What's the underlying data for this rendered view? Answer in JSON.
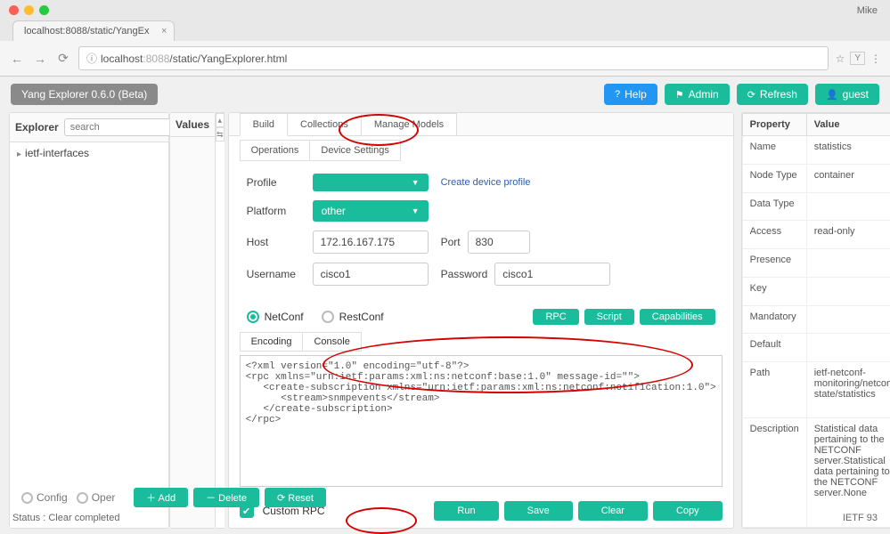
{
  "browser": {
    "user": "Mike",
    "tab_title": "localhost:8088/static/YangEx",
    "url_host": "localhost",
    "url_port": ":8088",
    "url_path": "/static/YangExplorer.html"
  },
  "app": {
    "title": "Yang Explorer 0.6.0 (Beta)",
    "help": "Help",
    "admin": "Admin",
    "refresh": "Refresh",
    "guest": "guest"
  },
  "explorer": {
    "title": "Explorer",
    "search_placeholder": "search",
    "tree_item": "ietf-interfaces",
    "values_title": "Values",
    "config": "Config",
    "oper": "Oper",
    "add": "Add",
    "delete": "Delete",
    "reset": "Reset"
  },
  "center": {
    "tabs": {
      "build": "Build",
      "collections": "Collections",
      "manage": "Manage Models"
    },
    "subtabs": {
      "operations": "Operations",
      "device": "Device Settings"
    },
    "profile_label": "Profile",
    "profile_value": "",
    "create_profile": "Create device profile",
    "platform_label": "Platform",
    "platform_value": "other",
    "host_label": "Host",
    "host_value": "172.16.167.175",
    "port_label": "Port",
    "port_value": "830",
    "user_label": "Username",
    "user_value": "cisco1",
    "pass_label": "Password",
    "pass_value": "cisco1",
    "netconf": "NetConf",
    "restconf": "RestConf",
    "rpc": "RPC",
    "script": "Script",
    "caps": "Capabilities",
    "encoding": "Encoding",
    "console": "Console",
    "xml": "<?xml version=\"1.0\" encoding=\"utf-8\"?>\n<rpc xmlns=\"urn:ietf:params:xml:ns:netconf:base:1.0\" message-id=\"\">\n   <create-subscription xmlns=\"urn:ietf:params:xml:ns:netconf:notification:1.0\">\n      <stream>snmpevents</stream>\n   </create-subscription>\n</rpc>",
    "custom_rpc": "Custom RPC",
    "run": "Run",
    "save": "Save",
    "clear": "Clear",
    "copy": "Copy"
  },
  "props": {
    "header_prop": "Property",
    "header_val": "Value",
    "rows": [
      {
        "k": "Name",
        "v": "statistics"
      },
      {
        "k": "Node Type",
        "v": "container"
      },
      {
        "k": "Data Type",
        "v": ""
      },
      {
        "k": "Access",
        "v": "read-only"
      },
      {
        "k": "Presence",
        "v": ""
      },
      {
        "k": "Key",
        "v": ""
      },
      {
        "k": "Mandatory",
        "v": ""
      },
      {
        "k": "Default",
        "v": ""
      },
      {
        "k": "Path",
        "v": "ietf-netconf-monitoring/netconf-state/statistics"
      },
      {
        "k": "Description",
        "v": "Statistical data pertaining to the NETCONF server.Statistical data pertaining to the NETCONF server.None"
      }
    ]
  },
  "status": {
    "text": "Status : Clear completed",
    "right": "IETF 93"
  }
}
